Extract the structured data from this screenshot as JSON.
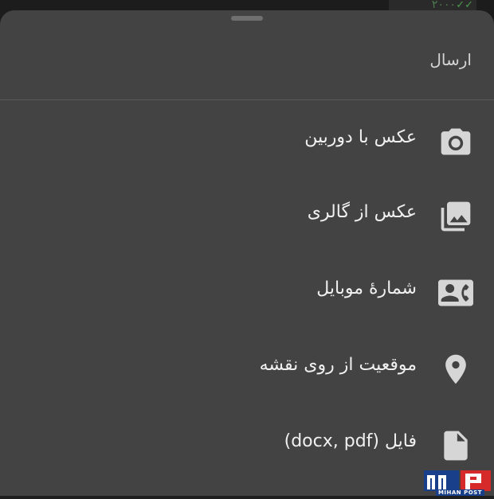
{
  "background": {
    "peek_text": "۲۰۰۰"
  },
  "sheet": {
    "title": "ارسال",
    "items": [
      {
        "label": "عکس با دوربین",
        "icon": "camera-icon"
      },
      {
        "label": "عکس از گالری",
        "icon": "gallery-icon"
      },
      {
        "label": "شمارهٔ موبایل",
        "icon": "contact-phone-icon"
      },
      {
        "label": "موقعیت از روی نقشه",
        "icon": "location-pin-icon"
      },
      {
        "label": "فایل (docx, pdf)",
        "icon": "file-icon"
      }
    ]
  },
  "watermark": {
    "text": "MIHAN POST"
  },
  "colors": {
    "sheet_bg": "#434343",
    "icon": "#d6d6d6",
    "text": "#f0f0f0",
    "divider": "#5a5a5a"
  }
}
